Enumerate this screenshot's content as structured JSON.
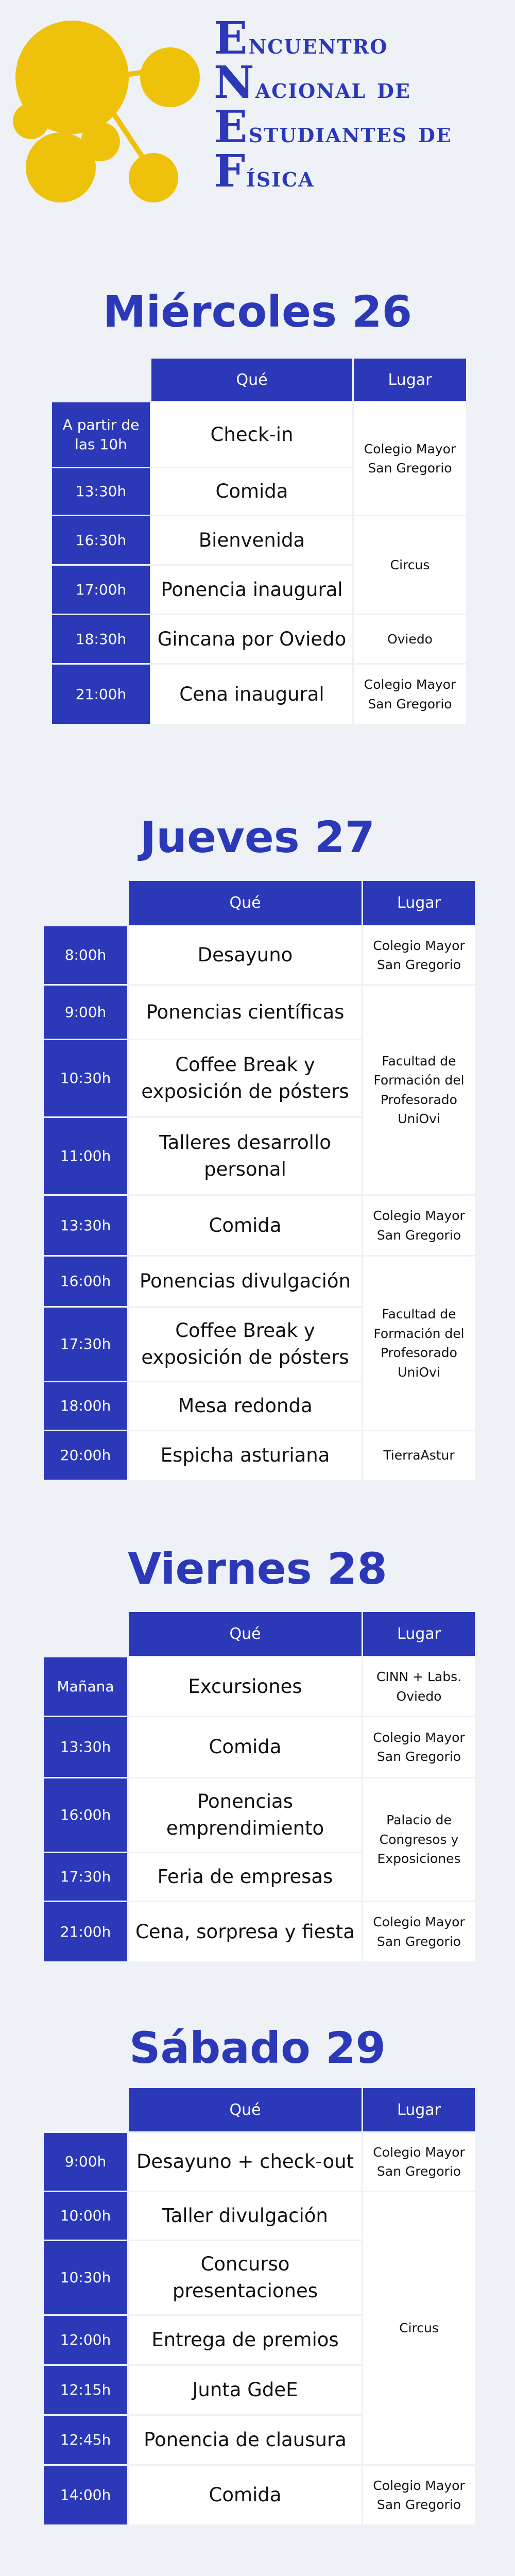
{
  "header": {
    "title_lines": [
      {
        "initial": "E",
        "rest": "ncuentro"
      },
      {
        "initial": "N",
        "rest": "acional de"
      },
      {
        "initial": "E",
        "rest": "studiantes de"
      },
      {
        "initial": "F",
        "rest": "ísica"
      }
    ],
    "logo_color": "#eec20b",
    "brand_color": "#2b39b9"
  },
  "days": [
    {
      "title": "Miércoles 26",
      "head_what": "Qué",
      "head_where": "Lugar",
      "rows": [
        {
          "time": "A partir de las 10h",
          "what": "Check-in",
          "where": "Colegio Mayor San Gregorio"
        },
        {
          "time": "13:30h",
          "what": "Comida",
          "where": null
        },
        {
          "time": "16:30h",
          "what": "Bienvenida",
          "where": "Circus"
        },
        {
          "time": "17:00h",
          "what": "Ponencia inaugural",
          "where": null
        },
        {
          "time": "18:30h",
          "what": "Gincana por Oviedo",
          "where": "Oviedo"
        },
        {
          "time": "21:00h",
          "what": "Cena inaugural",
          "where": "Colegio Mayor San Gregorio"
        }
      ]
    },
    {
      "title": "Jueves 27",
      "head_what": "Qué",
      "head_where": "Lugar",
      "rows": [
        {
          "time": "8:00h",
          "what": "Desayuno",
          "where": "Colegio Mayor San Gregorio"
        },
        {
          "time": "9:00h",
          "what": "Ponencias científicas",
          "where": "Facultad de Formación del Profesorado UniOvi"
        },
        {
          "time": "10:30h",
          "what": "Coffee Break y exposición de pósters",
          "where": null
        },
        {
          "time": "11:00h",
          "what": "Talleres desarrollo personal",
          "where": null
        },
        {
          "time": "13:30h",
          "what": "Comida",
          "where": "Colegio Mayor San Gregorio"
        },
        {
          "time": "16:00h",
          "what": "Ponencias divulgación",
          "where": "Facultad de Formación del Profesorado UniOvi"
        },
        {
          "time": "17:30h",
          "what": "Coffee Break y exposición de pósters",
          "where": null
        },
        {
          "time": "18:00h",
          "what": "Mesa redonda",
          "where": null
        },
        {
          "time": "20:00h",
          "what": "Espicha asturiana",
          "where": "TierraAstur"
        }
      ]
    },
    {
      "title": "Viernes 28",
      "head_what": "Qué",
      "head_where": "Lugar",
      "rows": [
        {
          "time": "Mañana",
          "what": "Excursiones",
          "where": "CINN + Labs. Oviedo"
        },
        {
          "time": "13:30h",
          "what": "Comida",
          "where": "Colegio Mayor San Gregorio"
        },
        {
          "time": "16:00h",
          "what": "Ponencias emprendimiento",
          "where": "Palacio de Congresos y Exposiciones"
        },
        {
          "time": "17:30h",
          "what": "Feria de empresas",
          "where": null
        },
        {
          "time": "21:00h",
          "what": "Cena, sorpresa y fiesta",
          "where": "Colegio Mayor San Gregorio"
        }
      ]
    },
    {
      "title": "Sábado 29",
      "head_what": "Qué",
      "head_where": "Lugar",
      "rows": [
        {
          "time": "9:00h",
          "what": "Desayuno + check-out",
          "where": "Colegio Mayor San Gregorio"
        },
        {
          "time": "10:00h",
          "what": "Taller divulgación",
          "where": "Circus"
        },
        {
          "time": "10:30h",
          "what": "Concurso presentaciones",
          "where": null
        },
        {
          "time": "12:00h",
          "what": "Entrega de premios",
          "where": null
        },
        {
          "time": "12:15h",
          "what": "Junta GdeE",
          "where": null
        },
        {
          "time": "12:45h",
          "what": "Ponencia de clausura",
          "where": null
        },
        {
          "time": "14:00h",
          "what": "Comida",
          "where": "Colegio Mayor San Gregorio"
        }
      ]
    }
  ]
}
